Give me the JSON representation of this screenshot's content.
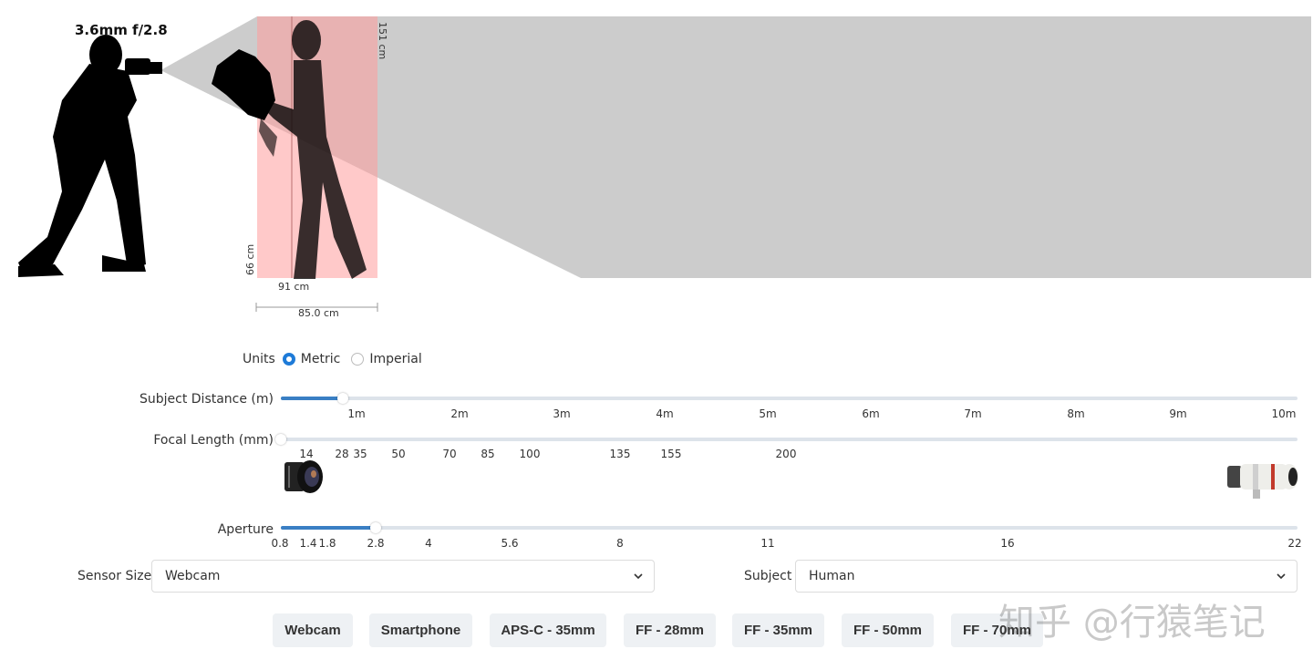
{
  "scene": {
    "lens_label": "3.6mm f/2.8",
    "height_label": "151 cm",
    "left_height_label": "66 cm",
    "subject_width_label": "91 cm",
    "field_width_label": "85.0 cm",
    "colors": {
      "frustum": "#cccccc",
      "frame": "#ff9c9c",
      "silhouette": "#000000"
    }
  },
  "units": {
    "label": "Units",
    "options": [
      {
        "label": "Metric",
        "selected": true
      },
      {
        "label": "Imperial",
        "selected": false
      }
    ]
  },
  "distance": {
    "label": "Subject Distance (m)",
    "value": 0.7,
    "min": 0.1,
    "max": 10,
    "ticks": [
      "1m",
      "2m",
      "3m",
      "4m",
      "5m",
      "6m",
      "7m",
      "8m",
      "9m",
      "10m"
    ]
  },
  "focal": {
    "label": "Focal Length (mm)",
    "value": 3.6,
    "ticks": [
      "14",
      "28",
      "35",
      "50",
      "70",
      "85",
      "100",
      "135",
      "155",
      "200"
    ],
    "wide_lens_icon": "wide-angle-lens-icon",
    "tele_lens_icon": "telephoto-lens-icon"
  },
  "aperture": {
    "label": "Aperture",
    "value": "2.8",
    "ticks": [
      "0.8",
      "1.4",
      "1.8",
      "2.8",
      "4",
      "5.6",
      "8",
      "11",
      "16",
      "22"
    ]
  },
  "sensor": {
    "label": "Sensor Size",
    "value": "Webcam"
  },
  "subject": {
    "label": "Subject",
    "value": "Human"
  },
  "presets": [
    "Webcam",
    "Smartphone",
    "APS-C - 35mm",
    "FF - 28mm",
    "FF - 35mm",
    "FF - 50mm",
    "FF - 70mm"
  ],
  "watermark": "知乎 @行猿笔记"
}
